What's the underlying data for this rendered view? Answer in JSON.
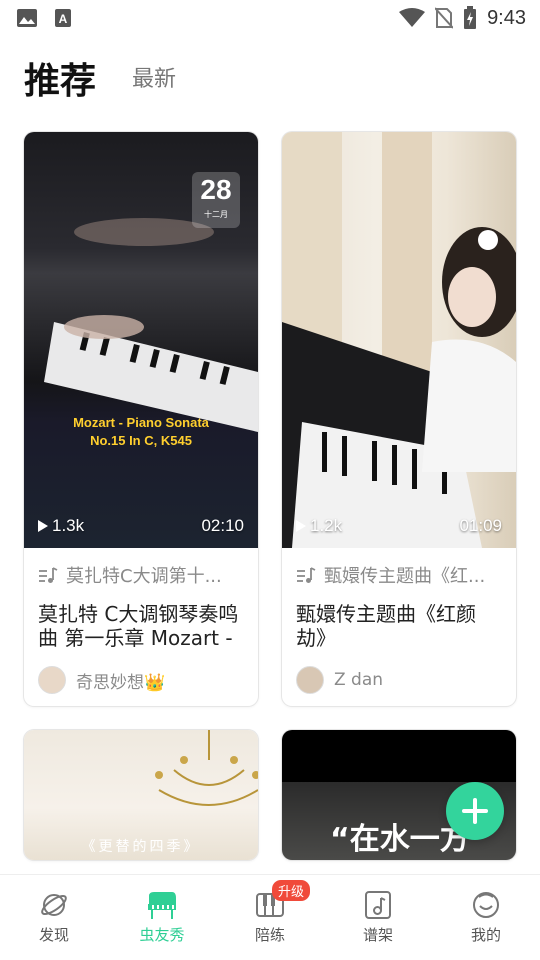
{
  "status_bar": {
    "time": "9:43"
  },
  "header": {
    "tabs": [
      {
        "label": "推荐",
        "active": true
      },
      {
        "label": "最新",
        "active": false
      }
    ]
  },
  "feed": {
    "cards": [
      {
        "thumb_date": "28",
        "thumb_month": "十二月",
        "thumb_caption_line1": "Mozart - Piano Sonata",
        "thumb_caption_line2": "No.15 In C, K545",
        "plays": "1.3k",
        "duration": "02:10",
        "song": "莫扎特C大调第十...",
        "title": "莫扎特 C大调钢琴奏鸣曲 第一乐章 Mozart - ...",
        "author": "奇思妙想👑"
      },
      {
        "plays": "1.2k",
        "duration": "01:09",
        "song": "甄嬛传主题曲《红...",
        "title": "甄嬛传主题曲《红颜劫》",
        "author": "Z dan"
      },
      {
        "thumb_caption": "《更替的四季》"
      },
      {
        "thumb_caption": "“在水一方"
      }
    ]
  },
  "fab": {
    "icon": "plus-icon"
  },
  "tab_bar": {
    "items": [
      {
        "label": "发现",
        "icon": "planet-icon"
      },
      {
        "label": "虫友秀",
        "icon": "piano-icon",
        "active": true
      },
      {
        "label": "陪练",
        "icon": "keyboard-icon",
        "badge": "升级"
      },
      {
        "label": "谱架",
        "icon": "music-note-icon"
      },
      {
        "label": "我的",
        "icon": "smiley-icon"
      }
    ]
  },
  "colors": {
    "accent": "#33d49c",
    "badge": "#f04a3a"
  }
}
